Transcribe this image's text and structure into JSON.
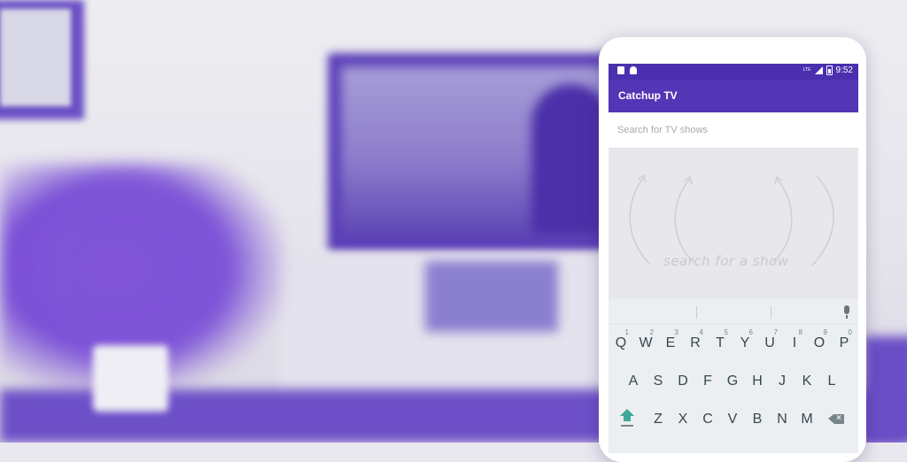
{
  "status_bar": {
    "network": "LTE",
    "time": "9:52"
  },
  "app_bar": {
    "title": "Catchup TV"
  },
  "search": {
    "placeholder": "Search for TV shows",
    "value": ""
  },
  "empty_state": {
    "hint": "search for a show"
  },
  "keyboard": {
    "row1": [
      {
        "key": "Q",
        "hint": "1"
      },
      {
        "key": "W",
        "hint": "2"
      },
      {
        "key": "E",
        "hint": "3"
      },
      {
        "key": "R",
        "hint": "4"
      },
      {
        "key": "T",
        "hint": "5"
      },
      {
        "key": "Y",
        "hint": "6"
      },
      {
        "key": "U",
        "hint": "7"
      },
      {
        "key": "I",
        "hint": "8"
      },
      {
        "key": "O",
        "hint": "9"
      },
      {
        "key": "P",
        "hint": "0"
      }
    ],
    "row2": [
      "A",
      "S",
      "D",
      "F",
      "G",
      "H",
      "J",
      "K",
      "L"
    ],
    "row3": [
      "Z",
      "X",
      "C",
      "V",
      "B",
      "N",
      "M"
    ]
  },
  "colors": {
    "status_bar": "#4a2fae",
    "app_bar": "#5236b6",
    "shift_accent": "#3fa79a",
    "background_accent": "#6a4fc4"
  },
  "icons": [
    "sd-card-icon",
    "android-icon",
    "signal-icon",
    "battery-icon",
    "mic-icon",
    "shift-icon",
    "backspace-icon"
  ]
}
